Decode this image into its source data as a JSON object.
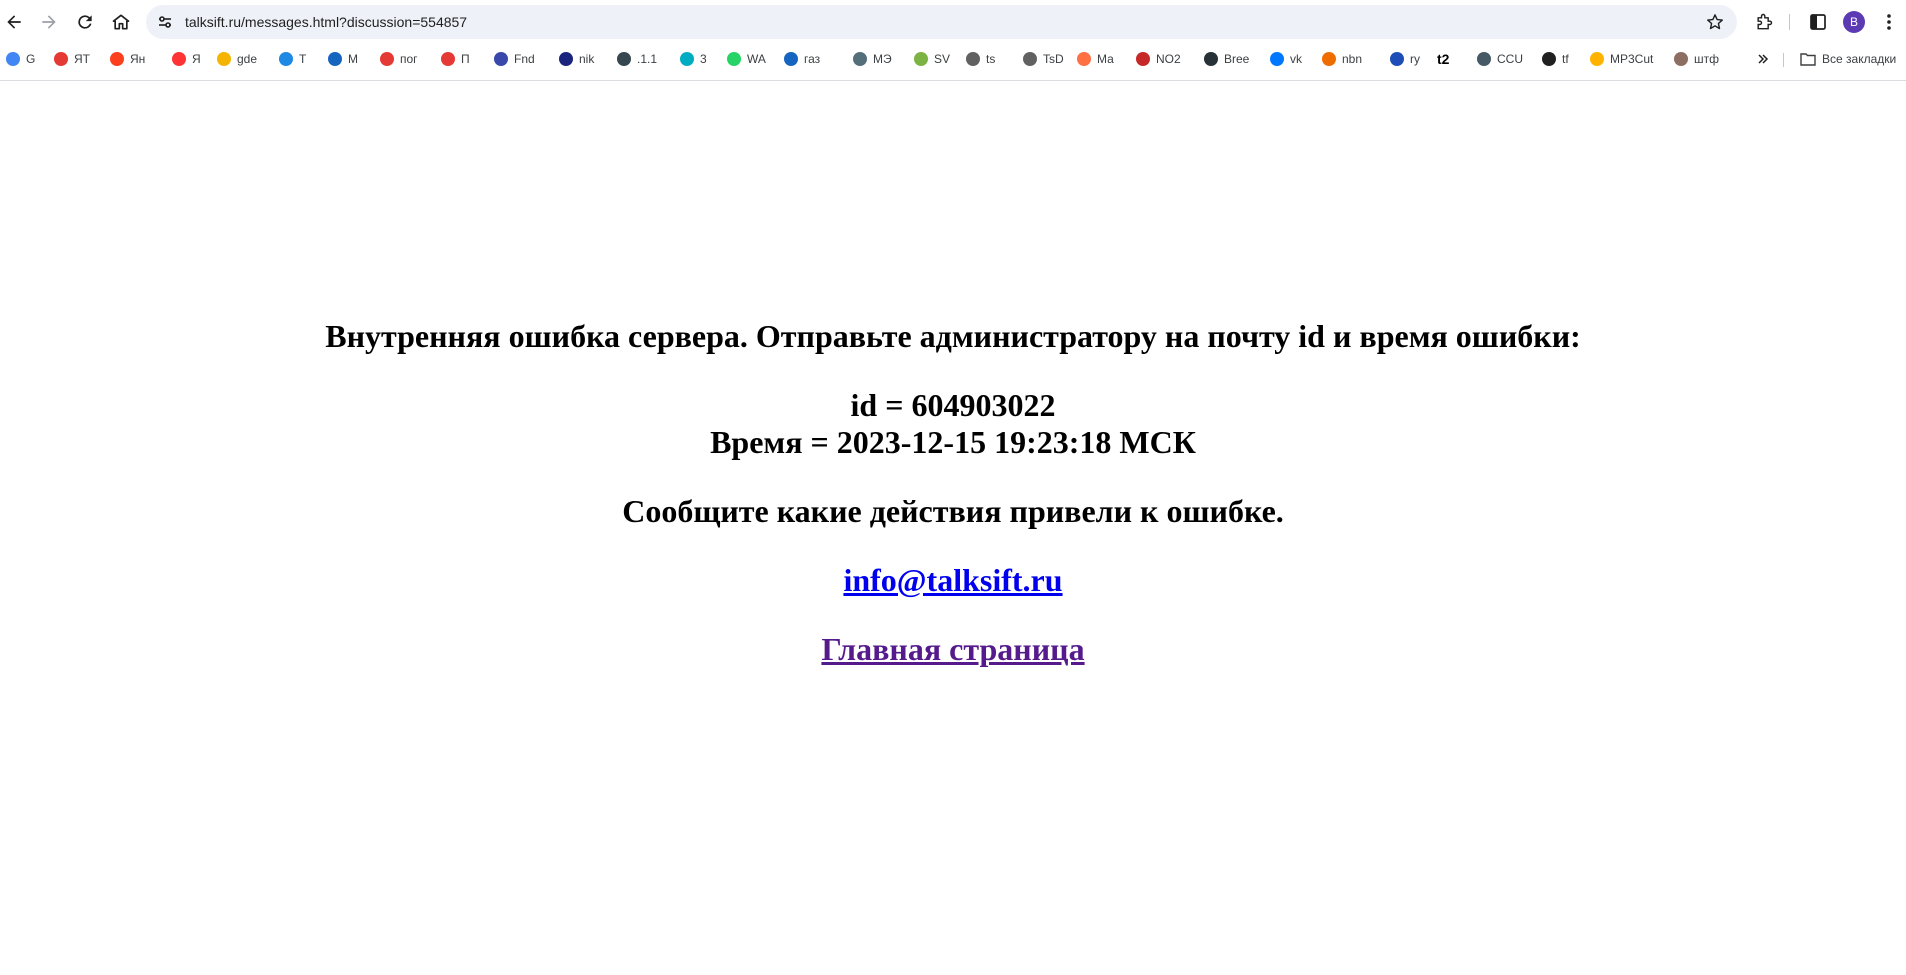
{
  "browser": {
    "url": "talksift.ru/messages.html?discussion=554857",
    "avatar_letter": "B",
    "bookmarks": [
      {
        "label": "G",
        "icon": "google-icon",
        "color": "#4285f4"
      },
      {
        "label": "ЯТ",
        "icon": "yandex-translate-icon",
        "color": "#e53935"
      },
      {
        "label": "Ян",
        "icon": "yandex-icon",
        "color": "#fc3f1d"
      },
      {
        "label": "Я",
        "icon": "map-pin-icon",
        "color": "#ff3333"
      },
      {
        "label": "gde",
        "icon": "info-circle-icon",
        "color": "#f4b400"
      },
      {
        "label": "T",
        "icon": "compass-icon",
        "color": "#1e88e5"
      },
      {
        "label": "M",
        "icon": "at-icon",
        "color": "#1565c0"
      },
      {
        "label": "пог",
        "icon": "umbrella-icon",
        "color": "#e53935"
      },
      {
        "label": "П",
        "icon": "umbrella-icon",
        "color": "#e53935"
      },
      {
        "label": "Fnd",
        "icon": "shield-icon",
        "color": "#3949ab"
      },
      {
        "label": "nik",
        "icon": "ru-icon",
        "color": "#1a237e"
      },
      {
        "label": ".1.1",
        "icon": "square-icon",
        "color": "#37474f"
      },
      {
        "label": "3",
        "icon": "z-icon",
        "color": "#00acc1"
      },
      {
        "label": "WA",
        "icon": "whatsapp-icon",
        "color": "#25d366"
      },
      {
        "label": "газ",
        "icon": "flame-icon",
        "color": "#1565c0"
      },
      {
        "label": "МЭ",
        "icon": "mos-icon",
        "color": "#546e7a"
      },
      {
        "label": "SV",
        "icon": "download-icon",
        "color": "#7cb342"
      },
      {
        "label": "ts",
        "icon": "ticket-icon",
        "color": "#616161"
      },
      {
        "label": "TsD",
        "icon": "ticket-icon",
        "color": "#616161"
      },
      {
        "label": "Ма",
        "icon": "cloud-icon",
        "color": "#ff7043"
      },
      {
        "label": "NO2",
        "icon": "u-icon",
        "color": "#c62828"
      },
      {
        "label": "Bree",
        "icon": "leaf-icon",
        "color": "#263238"
      },
      {
        "label": "vk",
        "icon": "vk-icon",
        "color": "#0077ff"
      },
      {
        "label": "nbn",
        "icon": "f-bracket-icon",
        "color": "#ef6c00"
      },
      {
        "label": "ry",
        "icon": "russia-flag-icon",
        "color": "#1e4db7"
      },
      {
        "label": "",
        "icon": "t2-icon",
        "color": "#000000",
        "text_icon": "t2"
      },
      {
        "label": "CCU",
        "icon": "globe-icon",
        "color": "#455a64"
      },
      {
        "label": "tf",
        "icon": "fire-icon",
        "color": "#212121"
      },
      {
        "label": "MP3Cut",
        "icon": "dots-icon",
        "color": "#ffb300"
      },
      {
        "label": "штф",
        "icon": "badge-icon",
        "color": "#8d6e63"
      }
    ],
    "all_bookmarks_label": "Все закладки"
  },
  "page": {
    "error_title": "Внутренняя ошибка сервера. Отправьте администратору на почту id и время ошибки:",
    "error_id": "id = 604903022",
    "error_time": "Время = 2023-12-15 19:23:18 МСК",
    "report_prompt": "Сообщите какие действия привели к ошибке.",
    "email_link": "info@talksift.ru",
    "home_link": "Главная страница"
  }
}
